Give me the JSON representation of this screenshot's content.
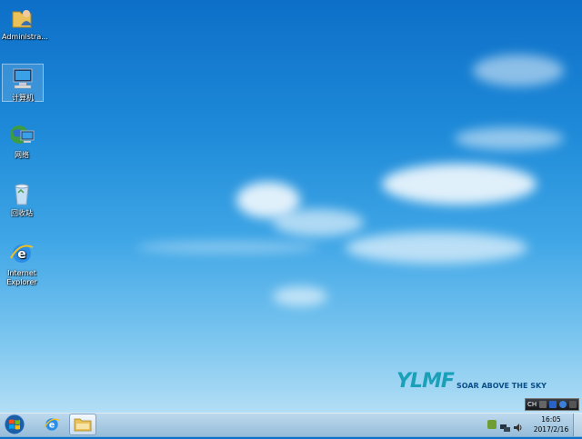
{
  "desktop": {
    "icons": [
      {
        "label": "Administra...",
        "icon": "user-folder-icon"
      },
      {
        "label": "计算机",
        "icon": "computer-icon"
      },
      {
        "label": "网络",
        "icon": "network-icon"
      },
      {
        "label": "回收站",
        "icon": "recycle-bin-icon"
      },
      {
        "label_line1": "Internet",
        "label_line2": "Explorer",
        "icon": "internet-explorer-icon"
      }
    ],
    "wallpaper_logo": {
      "mark": "YLMF",
      "tagline": "SOAR ABOVE THE SKY"
    }
  },
  "language_bar": {
    "label": "CH"
  },
  "taskbar": {
    "start_icon": "windows-start-icon",
    "pinned": [
      {
        "icon": "internet-explorer-icon"
      },
      {
        "icon": "file-explorer-icon",
        "active": true
      }
    ],
    "clock": {
      "time": "16:05",
      "date": "2017/2/16"
    }
  },
  "colors": {
    "accent": "#1e8ad8",
    "taskbar": "#a9c7e0"
  }
}
